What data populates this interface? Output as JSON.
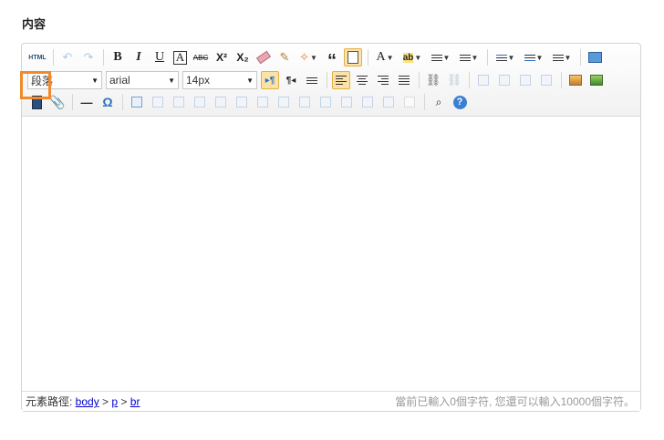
{
  "field": {
    "label": "内容"
  },
  "toolbar": {
    "html_label": "HTML",
    "undo": "↶",
    "redo": "↷",
    "bold": "B",
    "italic": "I",
    "underline": "U",
    "fontborder": "A",
    "strike": "ABC",
    "sup": "X²",
    "sub": "X₂",
    "quote": "“",
    "fontcolor": "A",
    "backcolor": "ab",
    "paragraph": "段落",
    "fontfamily": "arial",
    "fontsize": "14px",
    "ltr": "▸¶",
    "rtl": "¶◂",
    "hr": "—",
    "omega": "Ω",
    "help": "?"
  },
  "statusbar": {
    "path_label": "元素路徑: ",
    "path": [
      "body",
      "p",
      "br"
    ],
    "sep": " > ",
    "count": "當前已輸入0個字符, 您還可以輸入10000個字符。"
  },
  "colors": {
    "highlight": "#f08a2c",
    "active_bg": "#fbe2a6",
    "link": "#0000cc"
  }
}
